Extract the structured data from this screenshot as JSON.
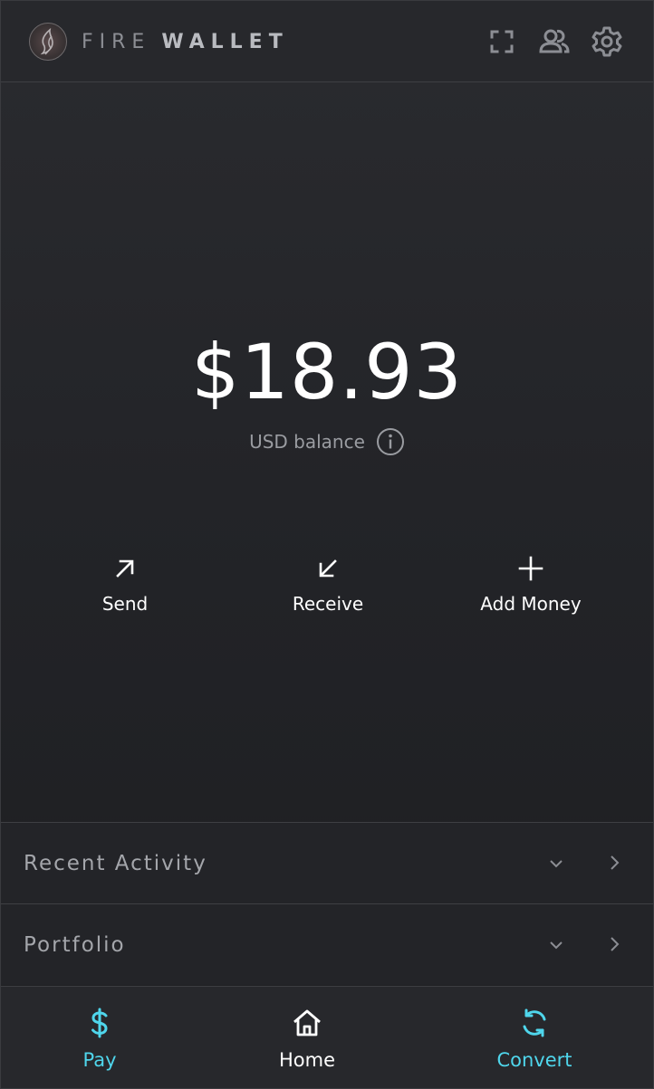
{
  "header": {
    "brand_part1": "FIRE",
    "brand_part2": "WALLET",
    "icons": [
      "scan-icon",
      "contacts-icon",
      "settings-icon"
    ]
  },
  "balance": {
    "amount": "$18.93",
    "caption": "USD balance"
  },
  "actions": [
    {
      "label": "Send",
      "icon": "arrow-up-right-icon"
    },
    {
      "label": "Receive",
      "icon": "arrow-down-left-icon"
    },
    {
      "label": "Add Money",
      "icon": "plus-icon"
    }
  ],
  "sections": [
    {
      "title": "Recent Activity"
    },
    {
      "title": "Portfolio"
    }
  ],
  "nav": [
    {
      "label": "Pay",
      "icon": "dollar-icon",
      "color": "#4fd6ec"
    },
    {
      "label": "Home",
      "icon": "home-icon",
      "color": "#ffffff"
    },
    {
      "label": "Convert",
      "icon": "refresh-icon",
      "color": "#4fd6ec"
    }
  ],
  "colors": {
    "accent": "#4fd6ec",
    "background": "#232428",
    "text_primary": "#ffffff",
    "text_muted": "#9a9ca1"
  }
}
